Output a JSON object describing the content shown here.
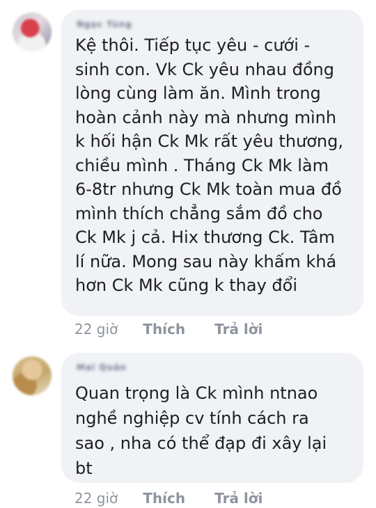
{
  "comments": [
    {
      "author": "Ngọc Tùng",
      "text": "Kệ thôi. Tiếp tục yêu - cưới  -\nsinh con. Vk Ck yêu nhau đồng\nlòng cùng làm ăn. Mình trong\nhoàn cảnh này mà nhưng mình\nk hối hận Ck Mk rất yêu thương,\nchiều mình . Tháng Ck Mk làm\n6-8tr nhưng Ck Mk toàn mua đồ\nmình thích chẳng sắm đồ cho\nCk Mk j cả. Hix thương Ck. Tâm\nlí nữa. Mong sau này khấm khá\nhơn Ck Mk cũng k thay đổi",
      "time": "22 giờ",
      "like_label": "Thích",
      "reply_label": "Trả lời"
    },
    {
      "author": "Mai Quân",
      "text": "Quan trọng là Ck mình ntnao\nnghề nghiệp cv tính cách ra\nsao , nha có thể đạp đi xây lại\nbt",
      "time": "22 giờ",
      "like_label": "Thích",
      "reply_label": "Trả lời"
    }
  ]
}
